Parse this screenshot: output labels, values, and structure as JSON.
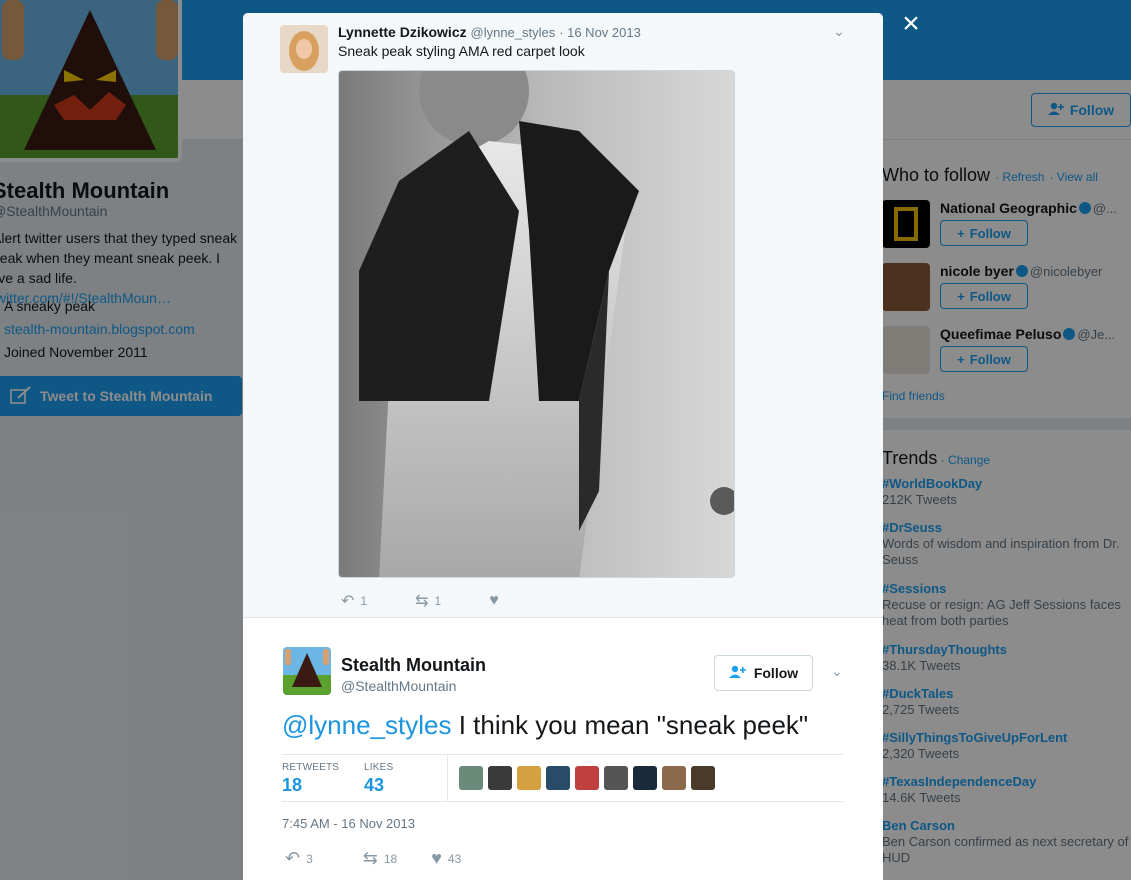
{
  "background": {
    "profile": {
      "name": "Stealth Mountain",
      "handle": "@StealthMountain",
      "bio_text": "Alert twitter users that they typed sneak peak when they meant sneak peek. I live a sad life.",
      "bio_link": "twitter.com/#!/StealthMoun…",
      "location": "A sneaky peak",
      "website": "stealth-mountain.blogspot.com",
      "joined": "Joined November 2011",
      "tweet_to_label": "Tweet to Stealth Mountain"
    },
    "header_follow_label": "Follow",
    "who_to_follow": {
      "title": "Who to follow",
      "refresh": "Refresh",
      "view_all": "View all",
      "follow_label": "Follow",
      "users": [
        {
          "name": "National Geographic",
          "handle": "@..."
        },
        {
          "name": "nicole byer",
          "handle": "@nicolebyer"
        },
        {
          "name": "Queefimae Peluso",
          "handle": "@Je..."
        }
      ],
      "find_friends": "Find friends"
    },
    "trends": {
      "title": "Trends",
      "change": "Change",
      "items": [
        {
          "name": "#WorldBookDay",
          "detail": "212K Tweets"
        },
        {
          "name": "#DrSeuss",
          "detail": "Words of wisdom and inspiration from Dr. Seuss"
        },
        {
          "name": "#Sessions",
          "detail": "Recuse or resign: AG Jeff Sessions faces heat from both parties"
        },
        {
          "name": "#ThursdayThoughts",
          "detail": "38.1K Tweets"
        },
        {
          "name": "#DuckTales",
          "detail": "2,725 Tweets"
        },
        {
          "name": "#SillyThingsToGiveUpForLent",
          "detail": "2,320 Tweets"
        },
        {
          "name": "#TexasIndependenceDay",
          "detail": "14.6K Tweets"
        },
        {
          "name": "Ben Carson",
          "detail": "Ben Carson confirmed as next secretary of HUD"
        }
      ]
    }
  },
  "modal": {
    "close_icon": "×",
    "parent_tweet": {
      "name": "Lynnette Dzikowicz",
      "handle": "@lynne_styles",
      "date": "16 Nov 2013",
      "text": "Sneak peak styling AMA red carpet look",
      "reply_count": "1",
      "retweet_count": "1"
    },
    "main_tweet": {
      "name": "Stealth Mountain",
      "handle": "@StealthMountain",
      "follow_label": "Follow",
      "mention": "@lynne_styles",
      "text": " I think you mean \"sneak peek\"",
      "retweets_label": "RETWEETS",
      "retweets": "18",
      "likes_label": "LIKES",
      "likes": "43",
      "timestamp": "7:45 AM - 16 Nov 2013",
      "reply_count": "3",
      "retweet_count": "18",
      "like_count": "43"
    },
    "liker_colors": [
      "#6a8a7a",
      "#3a3a3a",
      "#d4a040",
      "#2a4a6a",
      "#c04040",
      "#555555",
      "#1a2a3a",
      "#8a6a4a",
      "#4a3a2a"
    ]
  }
}
